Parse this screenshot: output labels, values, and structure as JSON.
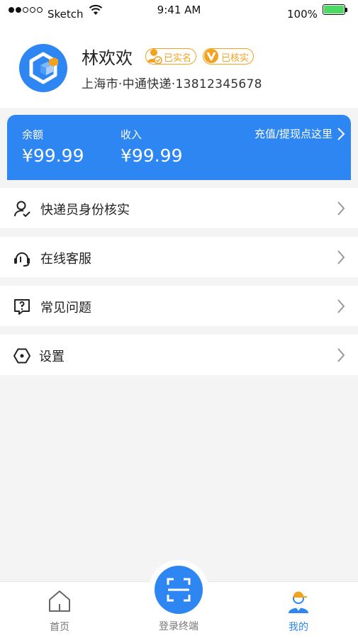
{
  "status_bar": {
    "carrier": "Sketch",
    "time": "9:41 AM",
    "battery": "100%"
  },
  "profile": {
    "name": "林欢欢",
    "badge_real_name": "已实名",
    "badge_verified": "已核实",
    "info": "上海市·中通快递·13812345678"
  },
  "balance": {
    "balance_label": "余额",
    "balance_value": "¥99.99",
    "income_label": "收入",
    "income_value": "¥99.99",
    "action_label": "充值/提现点这里"
  },
  "menu": [
    {
      "label": "快递员身份核实",
      "icon": "user-check-icon"
    },
    {
      "label": "在线客服",
      "icon": "headset-icon"
    },
    {
      "label": "常见问题",
      "icon": "question-bubble-icon"
    },
    {
      "label": "设置",
      "icon": "hexagon-settings-icon"
    }
  ],
  "tabbar": {
    "home": "首页",
    "scan": "登录终端",
    "mine": "我的"
  },
  "colors": {
    "accent": "#2d86f2",
    "badge": "#f2a21f",
    "background": "#f4f4f4"
  }
}
